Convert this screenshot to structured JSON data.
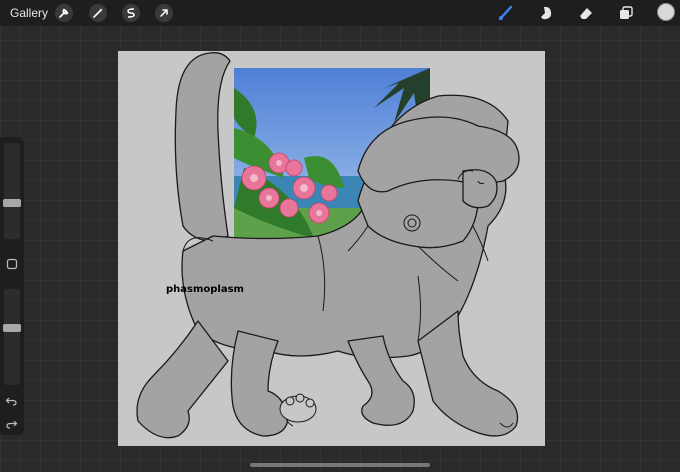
{
  "topbar": {
    "gallery_label": "Gallery",
    "left_tools": [
      "wrench-icon",
      "magic-wand-icon",
      "selection-icon",
      "transform-arrow-icon"
    ],
    "right_tools": [
      "brush-icon",
      "smudge-icon",
      "eraser-icon",
      "layers-icon",
      "color-swatch-icon"
    ],
    "active_color": "#d9d9d9",
    "brush_accent": "#3b82f6"
  },
  "sidebar": {
    "brush_size_level": 0.6,
    "opacity_level": 0.4,
    "tools": [
      "modify-square-icon",
      "undo-icon",
      "redo-icon"
    ]
  },
  "canvas": {
    "watermark_text": "phasmoplasm",
    "background_color": "#c7c7c7",
    "creature_color": "#a3a3a3"
  }
}
